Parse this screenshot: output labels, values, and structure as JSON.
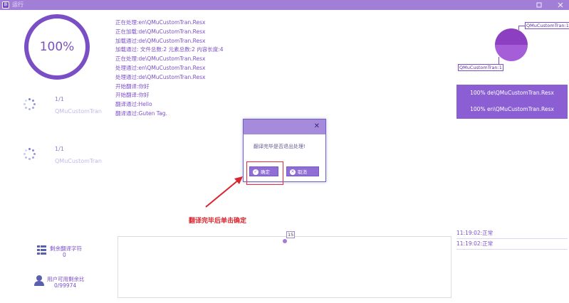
{
  "window": {
    "title": "运行",
    "logo_text": "翻",
    "icons": {
      "restore": "restore-icon",
      "close": "close-icon"
    }
  },
  "progress": {
    "label": "100%",
    "value": 1.0
  },
  "tasks": [
    {
      "count": "1/1",
      "name": "QMuCustomTran"
    },
    {
      "count": "1/1",
      "name": "QMuCustomTran"
    }
  ],
  "log": [
    "正在处理:en\\QMuCustomTran.Resx",
    "正在加载:de\\QMuCustomTran.Resx",
    "加载通过:de\\QMuCustomTran.Resx",
    "加载通过: 文件总数:2 元素总数:2 内容长度:4",
    "正在处理:de\\QMuCustomTran.Resx",
    "处理通过:en\\QMuCustomTran.Resx",
    "处理通过:de\\QMuCustomTran.Resx",
    "开始翻译:你好",
    "开始翻译:你好",
    "翻译通过:Hello",
    "翻译通过:Guten Tag."
  ],
  "pie": {
    "labels": [
      "QMuCustomTran:1",
      "QMuCustomTran:1"
    ],
    "values": [
      1,
      1
    ],
    "colors": [
      "#8d3fc1",
      "#a65dd8"
    ]
  },
  "files": [
    "100% de\\QMuCustomTran.Resx",
    "100% en\\QMuCustomTran.Resx"
  ],
  "dialog": {
    "message": "翻译完毕是否退出处理!",
    "confirm_label": "确定",
    "cancel_label": "取消",
    "close_glyph": "✕"
  },
  "annotation": {
    "text": "翻译完毕后单击确定",
    "color": "#d9252e"
  },
  "stats": {
    "remaining_label": "剩余翻译字符",
    "remaining_value": "0",
    "user_label": "用户可用剩余比",
    "user_value": "0/99974"
  },
  "chart_data": {
    "type": "line",
    "x": [
      0
    ],
    "values": [
      15
    ],
    "data_labels": [
      "15"
    ],
    "grid": false
  },
  "times": [
    "11:19:02:正常",
    "11:19:02:正常"
  ],
  "colors": {
    "accent": "#7b4fc9",
    "titlebar": "#a27fd6",
    "panel": "#8b5fd3"
  }
}
